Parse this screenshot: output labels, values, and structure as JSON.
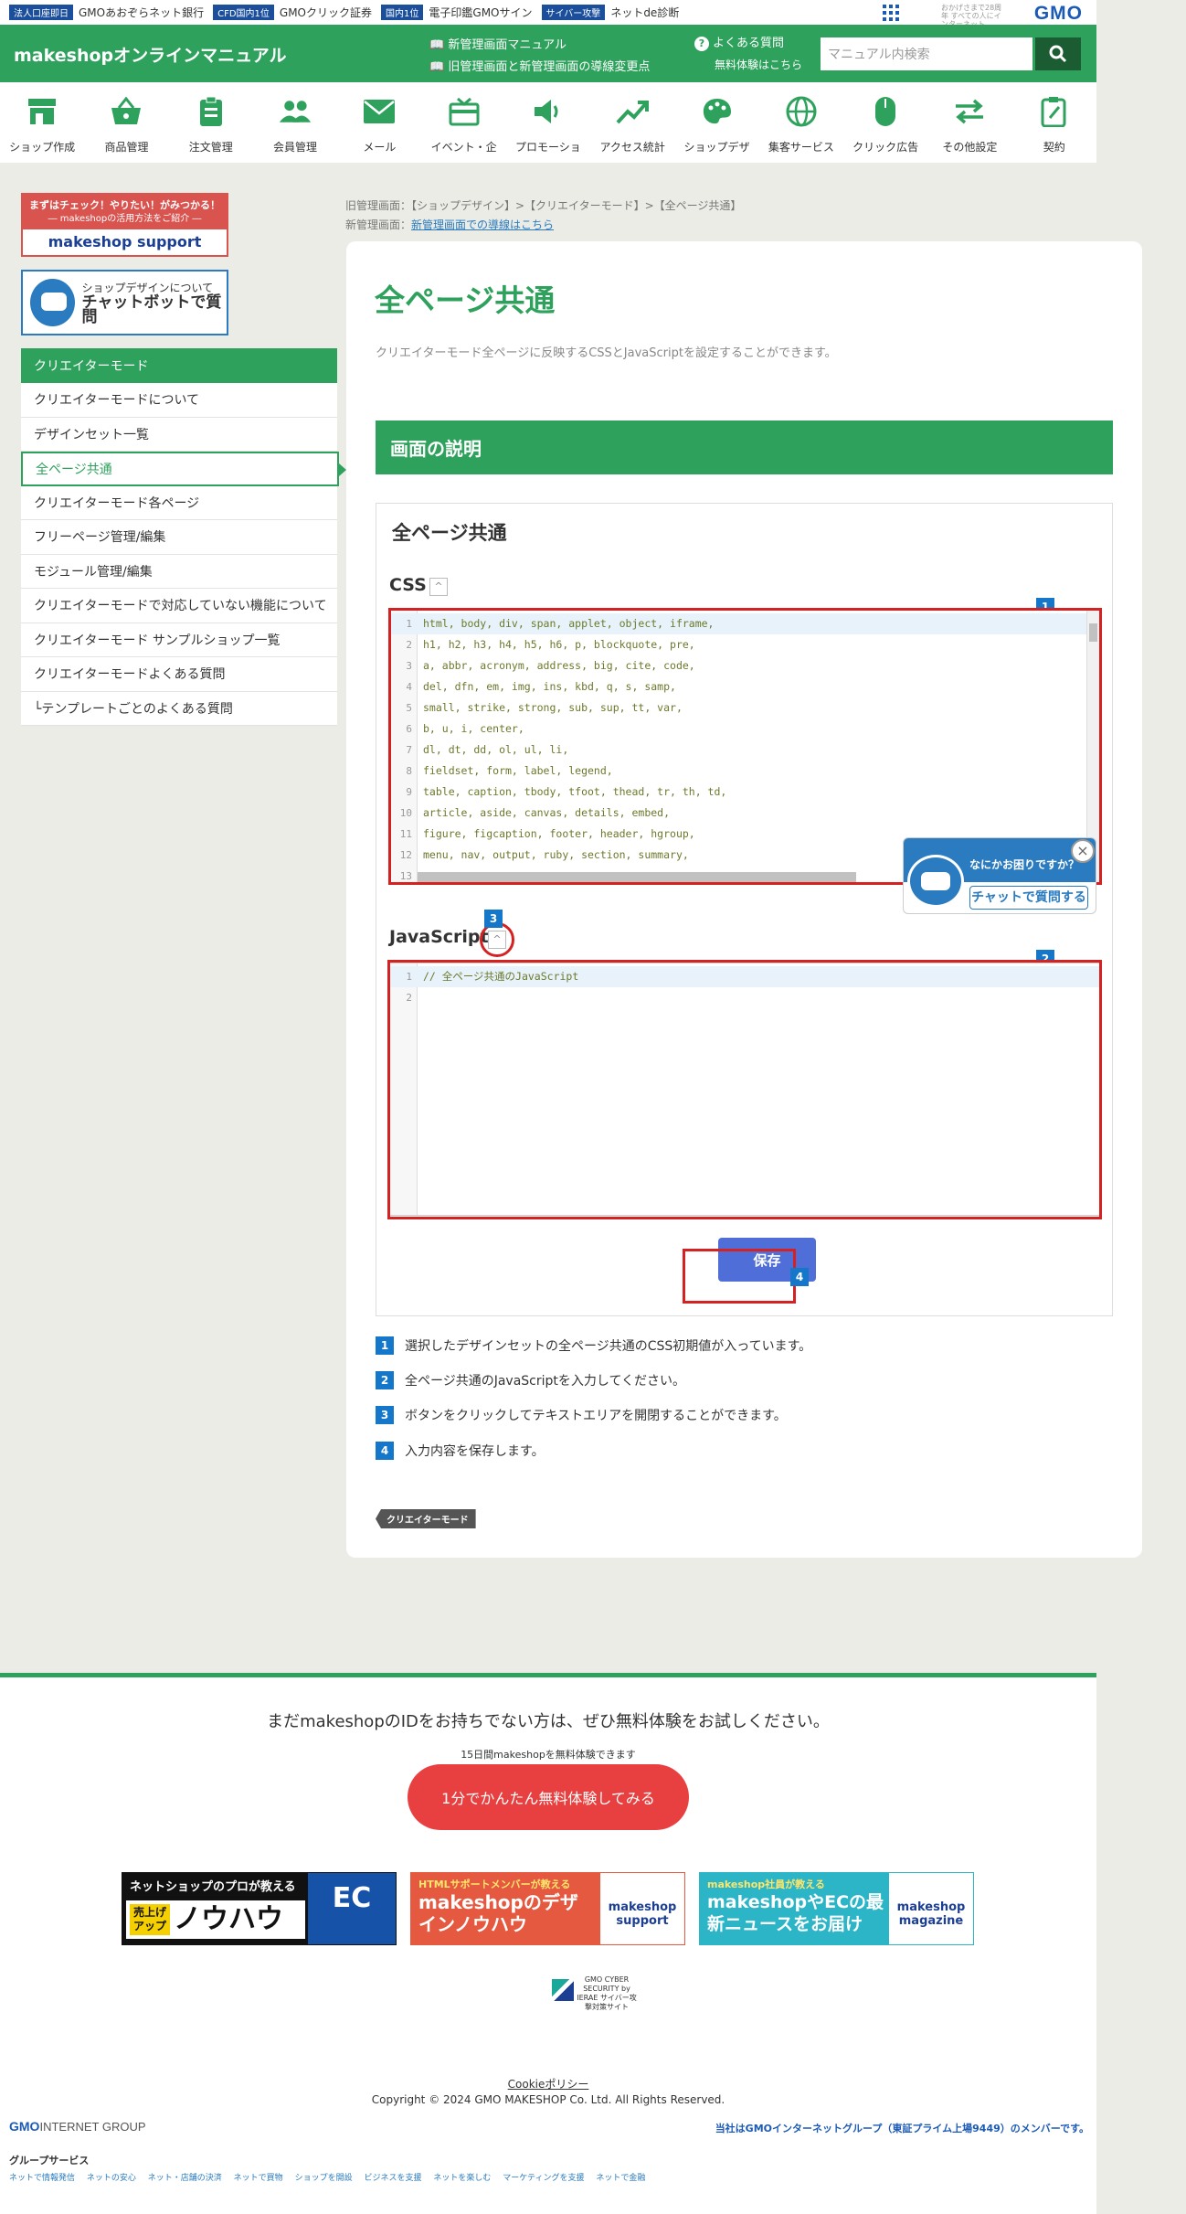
{
  "gmobar": {
    "items": [
      {
        "tag": "法人口座即日",
        "text": "GMOあおぞらネット銀行"
      },
      {
        "tag": "CFD国内1位",
        "text": "GMOクリック証券"
      },
      {
        "tag": "国内1位",
        "text": "電子印鑑GMOサイン"
      },
      {
        "tag": "サイバー攻撃",
        "text": "ネットde診断"
      }
    ],
    "anniversary": "おかげさまで28周年 すべての人にインターネット",
    "logo": "GMO"
  },
  "header": {
    "site_title": "makeshopオンラインマニュアル",
    "link_new_manual": "新管理画面マニュアル",
    "link_old_new": "旧管理画面と新管理画面の導線変更点",
    "link_faq": "よくある質問",
    "link_trial": "無料体験はこちら",
    "search_placeholder": "マニュアル内検索",
    "search_icon": "search-icon"
  },
  "nav": [
    {
      "label": "ショップ作成",
      "icon": "shop-icon"
    },
    {
      "label": "商品管理",
      "icon": "basket-icon"
    },
    {
      "label": "注文管理",
      "icon": "clipboard-icon"
    },
    {
      "label": "会員管理",
      "icon": "users-icon"
    },
    {
      "label": "メール",
      "icon": "mail-icon"
    },
    {
      "label": "イベント・企",
      "icon": "gift-icon"
    },
    {
      "label": "プロモーショ",
      "icon": "speaker-icon"
    },
    {
      "label": "アクセス統計",
      "icon": "trend-icon"
    },
    {
      "label": "ショップデザ",
      "icon": "palette-icon"
    },
    {
      "label": "集客サービス",
      "icon": "globe-icon"
    },
    {
      "label": "クリック広告",
      "icon": "mouse-icon"
    },
    {
      "label": "その他設定",
      "icon": "swap-icon"
    },
    {
      "label": "契約",
      "icon": "contract-icon"
    }
  ],
  "sidebar": {
    "banner1_top": "まずはチェック！やりたい！がみつかる！",
    "banner1_sub": "― makeshopの活用方法をご紹介 ―",
    "banner1_brand": "makeshop support",
    "banner2_line1": "ショップデザインについて",
    "banner2_line2": "チャットボットで質問",
    "menu_head": "クリエイターモード",
    "items": [
      "クリエイターモードについて",
      "デザインセット一覧",
      "全ページ共通",
      "クリエイターモード各ページ",
      "フリーページ管理/編集",
      "モジュール管理/編集",
      "クリエイターモードで対応していない機能について",
      "クリエイターモード サンプルショップ一覧",
      "クリエイターモードよくある質問",
      "└テンプレートごとのよくある質問"
    ]
  },
  "breadcrumb": {
    "old": "旧管理画面：【ショップデザイン】>【クリエイターモード】>【全ページ共通】",
    "new_prefix": "新管理画面：",
    "new_link": "新管理画面での導線はこちら"
  },
  "main": {
    "title": "全ページ共通",
    "description": "クリエイターモード全ページに反映するCSSとJavaScriptを設定することができます。",
    "section_head": "画面の説明",
    "panel_title": "全ページ共通",
    "css_label": "CSS",
    "js_label": "JavaScript",
    "toggle_glyph": "^",
    "css_lines": [
      {
        "n": "1",
        "code": "html, body, div, span, applet, object, iframe,"
      },
      {
        "n": "2",
        "code": "h1, h2, h3, h4, h5, h6, p, blockquote, pre,"
      },
      {
        "n": "3",
        "code": "a, abbr, acronym, address, big, cite, code,"
      },
      {
        "n": "4",
        "code": "del, dfn, em, img, ins, kbd, q, s, samp,"
      },
      {
        "n": "5",
        "code": "small, strike, strong, sub, sup, tt, var,"
      },
      {
        "n": "6",
        "code": "b, u, i, center,"
      },
      {
        "n": "7",
        "code": "dl, dt, dd, ol, ul, li,"
      },
      {
        "n": "8",
        "code": "fieldset, form, label, legend,"
      },
      {
        "n": "9",
        "code": "table, caption, tbody, tfoot, thead, tr, th, td,"
      },
      {
        "n": "10",
        "code": "article, aside, canvas, details, embed,"
      },
      {
        "n": "11",
        "code": "figure, figcaption, footer, header, hgroup,"
      },
      {
        "n": "12",
        "code": "menu, nav, output, ruby, section, summary,"
      },
      {
        "n": "13",
        "code": ""
      }
    ],
    "js_lines": [
      {
        "n": "1",
        "code": "// 全ページ共通のJavaScript"
      },
      {
        "n": "2",
        "code": ""
      }
    ],
    "markers": [
      "1",
      "2",
      "3",
      "4"
    ],
    "save_label": "保存",
    "notes": [
      {
        "num": "1",
        "text": "選択したデザインセットの全ページ共通のCSS初期値が入っています。"
      },
      {
        "num": "2",
        "text": "全ページ共通のJavaScriptを入力してください。"
      },
      {
        "num": "3",
        "text": "ボタンをクリックしてテキストエリアを開閉することができます。"
      },
      {
        "num": "4",
        "text": "入力内容を保存します。"
      }
    ],
    "tag": "クリエイターモード"
  },
  "chat_widget": {
    "question": "なにかお困りですか？",
    "button": "チャットで質問する",
    "close": "×"
  },
  "footer": {
    "trial_message": "まだmakeshopのIDをお持ちでない方は、ぜひ無料体験をお試しください。",
    "trial_sub": "15日間makeshopを無料体験できます",
    "trial_button": "1分でかんたん無料体験してみる",
    "banner1_top": "ネットショップのプロが教える",
    "banner1_sale": "売上げアップ",
    "banner1_main": "ノウハウ",
    "banner1_right": "EC",
    "banner2_small": "HTMLサポートメンバーが教える",
    "banner2_main": "makeshopのデザインノウハウ",
    "banner2_brand": "makeshop support",
    "banner3_small": "makeshop社員が教える",
    "banner3_main": "makeshopやECの最新ニュースをお届け",
    "banner3_brand": "makeshop magazine",
    "security_badge": "GMO CYBER SECURITY by IERAE サイバー攻撃対策サイト",
    "cookie_policy": "Cookieポリシー",
    "copyright": "Copyright © 2024 GMO MAKESHOP Co. Ltd. All Rights Reserved.",
    "group_logo": "GMO",
    "group_logo_rest": "INTERNET GROUP",
    "member_text": "当社はGMOインターネットグループ（東証プライム上場9449）のメンバーです。",
    "group_services_title": "グループサービス",
    "group_links": [
      "ネットで情報発信",
      "ネットの安心",
      "ネット・店舗の決済",
      "ネットで買物",
      "ショップを開設",
      "ビジネスを支援",
      "ネットを楽しむ",
      "マーケティングを支援",
      "ネットで金融"
    ]
  }
}
